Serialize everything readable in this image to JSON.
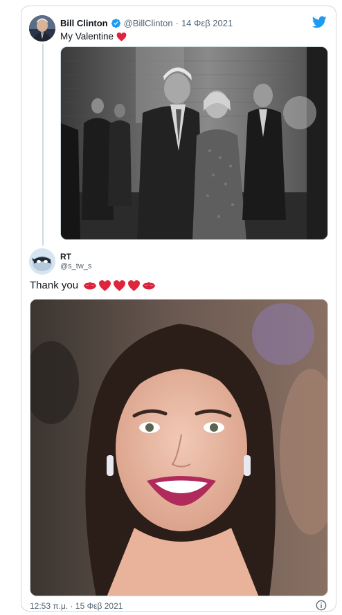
{
  "original_tweet": {
    "author_name": "Bill Clinton",
    "author_handle": "@BillClinton",
    "separator": "·",
    "date": "14 Φεβ 2021",
    "text": "My Valentine",
    "text_emoji": "heart-icon",
    "verified_icon": "verified-badge-icon",
    "avatar_icon": "avatar-bill-clinton"
  },
  "reply_tweet": {
    "author_name": "RT",
    "author_handle": "@s_tw_s",
    "text": "Thank you",
    "text_emojis": [
      "kiss-mark-icon",
      "heart-icon",
      "heart-icon",
      "heart-icon",
      "kiss-mark-icon"
    ],
    "timestamp": "12:53 π.μ. · 15 Φεβ 2021",
    "avatar_icon": "avatar-rt"
  },
  "icons": {
    "brand": "twitter-bird-icon",
    "info": "info-icon"
  },
  "colors": {
    "twitter_blue": "#1d9bf0",
    "heart_red": "#e0243c",
    "kiss_red": "#e0243c",
    "text_primary": "#0f1419",
    "text_secondary": "#536471",
    "border": "#cfd9de"
  }
}
